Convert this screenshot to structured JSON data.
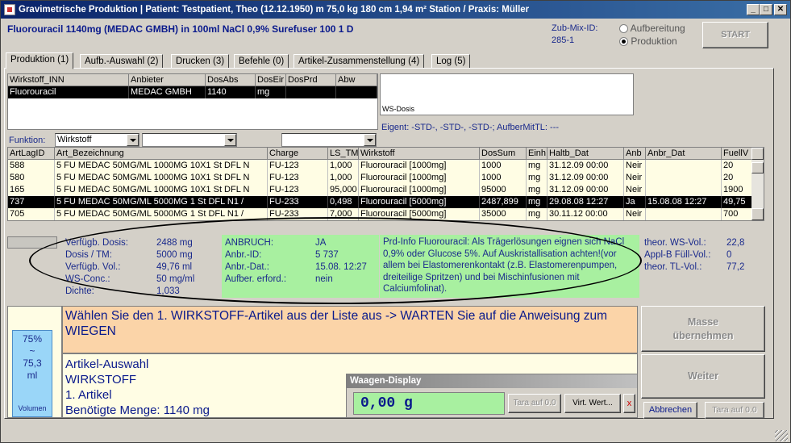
{
  "window": {
    "title": "Gravimetrische Produktion  |  Patient: Testpatient, Theo (12.12.1950) m 75,0 kg  180 cm  1,94 m² Station / Praxis: Müller",
    "minimize": "_",
    "maximize": "□",
    "close": "✕"
  },
  "header": {
    "product": "Fluorouracil 1140mg (MEDAC GMBH) in 100ml NaCl 0,9% Surefuser 100 1 D",
    "zubmix_label": "Zub-Mix-ID:",
    "zubmix_id": "285-1",
    "radio_aufbereitung": "Aufbereitung",
    "radio_produktion": "Produktion",
    "start_button": "START"
  },
  "tabs": [
    {
      "label": "Produktion (1)"
    },
    {
      "label": "Aufb.-Auswahl (2)"
    },
    {
      "label": "Drucken (3)"
    },
    {
      "label": "Befehle (0)"
    },
    {
      "label": "Artikel-Zusammenstellung (4)"
    },
    {
      "label": "Log (5)"
    }
  ],
  "wirkstoff_grid": {
    "headers": [
      "Wirkstoff_INN",
      "Anbieter",
      "DosAbs",
      "DosEir",
      "DosPrd",
      "Abw"
    ],
    "row": [
      "Fluorouracil",
      "MEDAC GMBH",
      "1140",
      "mg",
      "",
      ""
    ]
  },
  "ws_dosis": {
    "label": "WS-Dosis"
  },
  "eigent": "Eigent: -STD-, -STD-, -STD-; AufberMitTL: ---",
  "funktion": {
    "label": "Funktion:",
    "combo1": "Wirkstoff",
    "combo2": "",
    "combo3": ""
  },
  "artikel_grid": {
    "headers": [
      "ArtLagID",
      "Art_Bezeichnung",
      "Charge",
      "LS_TM",
      "Wirkstoff",
      "DosSum",
      "Einh",
      "Haltb_Dat",
      "Anb",
      "Anbr_Dat",
      "FuellV"
    ],
    "rows": [
      [
        "588",
        "5 FU MEDAC 50MG/ML 1000MG   10X1 St DFL N",
        "FU-123",
        "1,000",
        "Fluorouracil [1000mg]",
        "1000",
        "mg",
        "31.12.09 00:00",
        "Neir",
        "",
        "20"
      ],
      [
        "580",
        "5 FU MEDAC 50MG/ML 1000MG   10X1 St DFL N",
        "FU-123",
        "1,000",
        "Fluorouracil [1000mg]",
        "1000",
        "mg",
        "31.12.09 00:00",
        "Neir",
        "",
        "20"
      ],
      [
        "165",
        "5 FU MEDAC 50MG/ML 1000MG   10X1 St DFL N",
        "FU-123",
        "95,000",
        "Fluorouracil [1000mg]",
        "95000",
        "mg",
        "31.12.09 00:00",
        "Neir",
        "",
        "1900"
      ],
      [
        "737",
        "5 FU MEDAC 50MG/ML 5000MG   1 St DFL N1 / ",
        "FU-233",
        "0,498",
        "Fluorouracil [5000mg]",
        "2487,899",
        "mg",
        "29.08.08 12:27",
        "Ja",
        "15.08.08 12:27",
        "49,75"
      ],
      [
        "705",
        "5 FU MEDAC 50MG/ML 5000MG   1 St DFL N1 / ",
        "FU-233",
        "7,000",
        "Fluorouracil [5000mg]",
        "35000",
        "mg",
        "30.11.12 00:00",
        "Neir",
        "",
        "700"
      ]
    ]
  },
  "info_left": [
    {
      "k": "Verfügb. Dosis:",
      "v": "2488 mg"
    },
    {
      "k": "Dosis / TM:",
      "v": "5000 mg"
    },
    {
      "k": "Verfügb. Vol.:",
      "v": "49,76 ml"
    },
    {
      "k": "WS-Conc.:",
      "v": "50 mg/ml"
    },
    {
      "k": "Dichte:",
      "v": "1,033"
    }
  ],
  "info_green": [
    {
      "k": "ANBRUCH:",
      "v": "JA"
    },
    {
      "k": "Anbr.-ID:",
      "v": "5 737"
    },
    {
      "k": "Anbr.-Dat.:",
      "v": "15.08. 12:27"
    },
    {
      "k": "Aufber. erford.:",
      "v": "nein"
    }
  ],
  "prd_info": "Prd-Info Fluorouracil: Als Trägerlösungen eignen sich NaCl 0,9% oder Glucose 5%. Auf Auskristallisation achten!(vor allem bei Elastomerenkontakt (z.B. Elastomerenpumpen, dreiteilige Spritzen) und bei Mischinfusionen mit Calciumfolinat).",
  "info_right": [
    {
      "k": "theor. WS-Vol.:",
      "v": "22,8"
    },
    {
      "k": "Appl-B Füll-Vol.:",
      "v": "0"
    },
    {
      "k": "theor. TL-Vol.:",
      "v": "77,2"
    }
  ],
  "instruction": "Wählen Sie den 1. WIRKSTOFF-Artikel aus der Liste aus -> WARTEN Sie auf die Anweisung zum WIEGEN",
  "artikel_auswahl": [
    "Artikel-Auswahl",
    "WIRKSTOFF",
    "1. Artikel",
    "Benötigte Menge: 1140 mg"
  ],
  "volume": {
    "pct": "75%",
    "tilde": "~",
    "value": "75,3",
    "unit": "ml",
    "label": "Volumen",
    "fraction": 0.75
  },
  "waagen": {
    "title": "Waagen-Display",
    "value": "0,00 g",
    "tara_button": "Tara auf 0.0",
    "virt_button": "Virt. Wert...",
    "x_button": "x"
  },
  "buttons": {
    "masse": "Masse übernehmen",
    "weiter": "Weiter",
    "abbrechen": "Abbrechen",
    "tara": "Tara auf 0.0"
  }
}
